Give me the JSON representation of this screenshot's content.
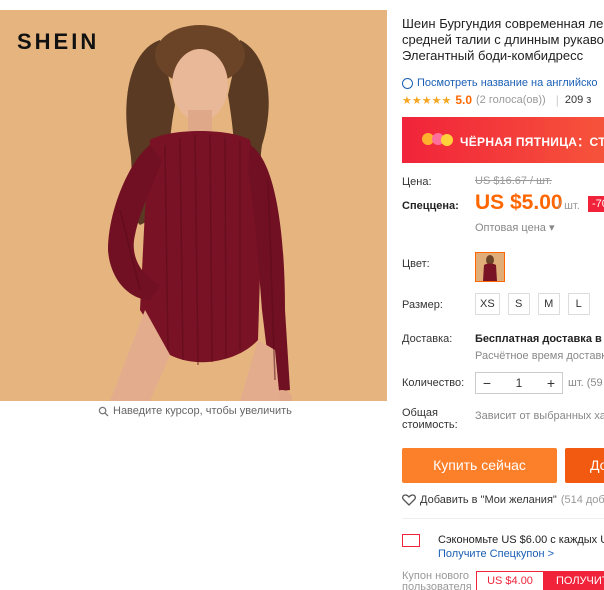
{
  "gallery": {
    "brand": "SHEIN",
    "zoom_hint": "Наведите курсор, чтобы увеличить"
  },
  "product": {
    "title_lines": [
      "Шеин Бургундия современная ле",
      "средней талии с длинным рукаво",
      "Элегантный боди-комбидресс"
    ],
    "translate_link": "Посмотреть название на английско",
    "stars": "★★★★★",
    "rating": "5.0",
    "votes": "(2 голоса(ов))",
    "rating_sep": "|",
    "orders": "209 з"
  },
  "banner": {
    "text": "ЧЁРНАЯ ПЯТНИЦА：СТ"
  },
  "price": {
    "label": "Цена:",
    "old": "US $16.67 / шт.",
    "sale_label": "Спеццена:",
    "new": "US $5.00",
    "per": "/ шт.",
    "discount": "-70",
    "wholesale": "Оптовая цена ▾"
  },
  "options": {
    "color_label": "Цвет:",
    "size_label": "Размер:",
    "sizes": [
      "XS",
      "S",
      "M",
      "L"
    ]
  },
  "shipping": {
    "label": "Доставка:",
    "main": "Бесплатная доставка в R",
    "sub": "Расчётное время доставки"
  },
  "quantity": {
    "label": "Количество:",
    "minus": "−",
    "value": "1",
    "plus": "+",
    "stock": "шт. (59"
  },
  "total": {
    "label_line1": "Общая",
    "label_line2": "стоимость:",
    "value": "Зависит от выбранных хар"
  },
  "actions": {
    "buy": "Купить сейчас",
    "cart": "До",
    "wishlist": "Добавить в \"Мои желания\"",
    "wishlist_count": "(514 доба"
  },
  "coupons": {
    "save_text": "Сэкономьте US $6.00 с каждых US",
    "save_link": "Получите Спецкупон >",
    "new_user_line1": "Купон нового",
    "new_user_line2": "пользователя",
    "amount": "US $4.00",
    "get": "ПОЛУЧИТ"
  },
  "colors": {
    "accent_orange": "#f60",
    "buy_button": "#fc7f2a",
    "cart_button": "#f35a11",
    "banner_red": "#f1233a",
    "link_blue": "#1a5fb4",
    "photo_bg": "#e5b47f",
    "garment": "#7a1225"
  }
}
